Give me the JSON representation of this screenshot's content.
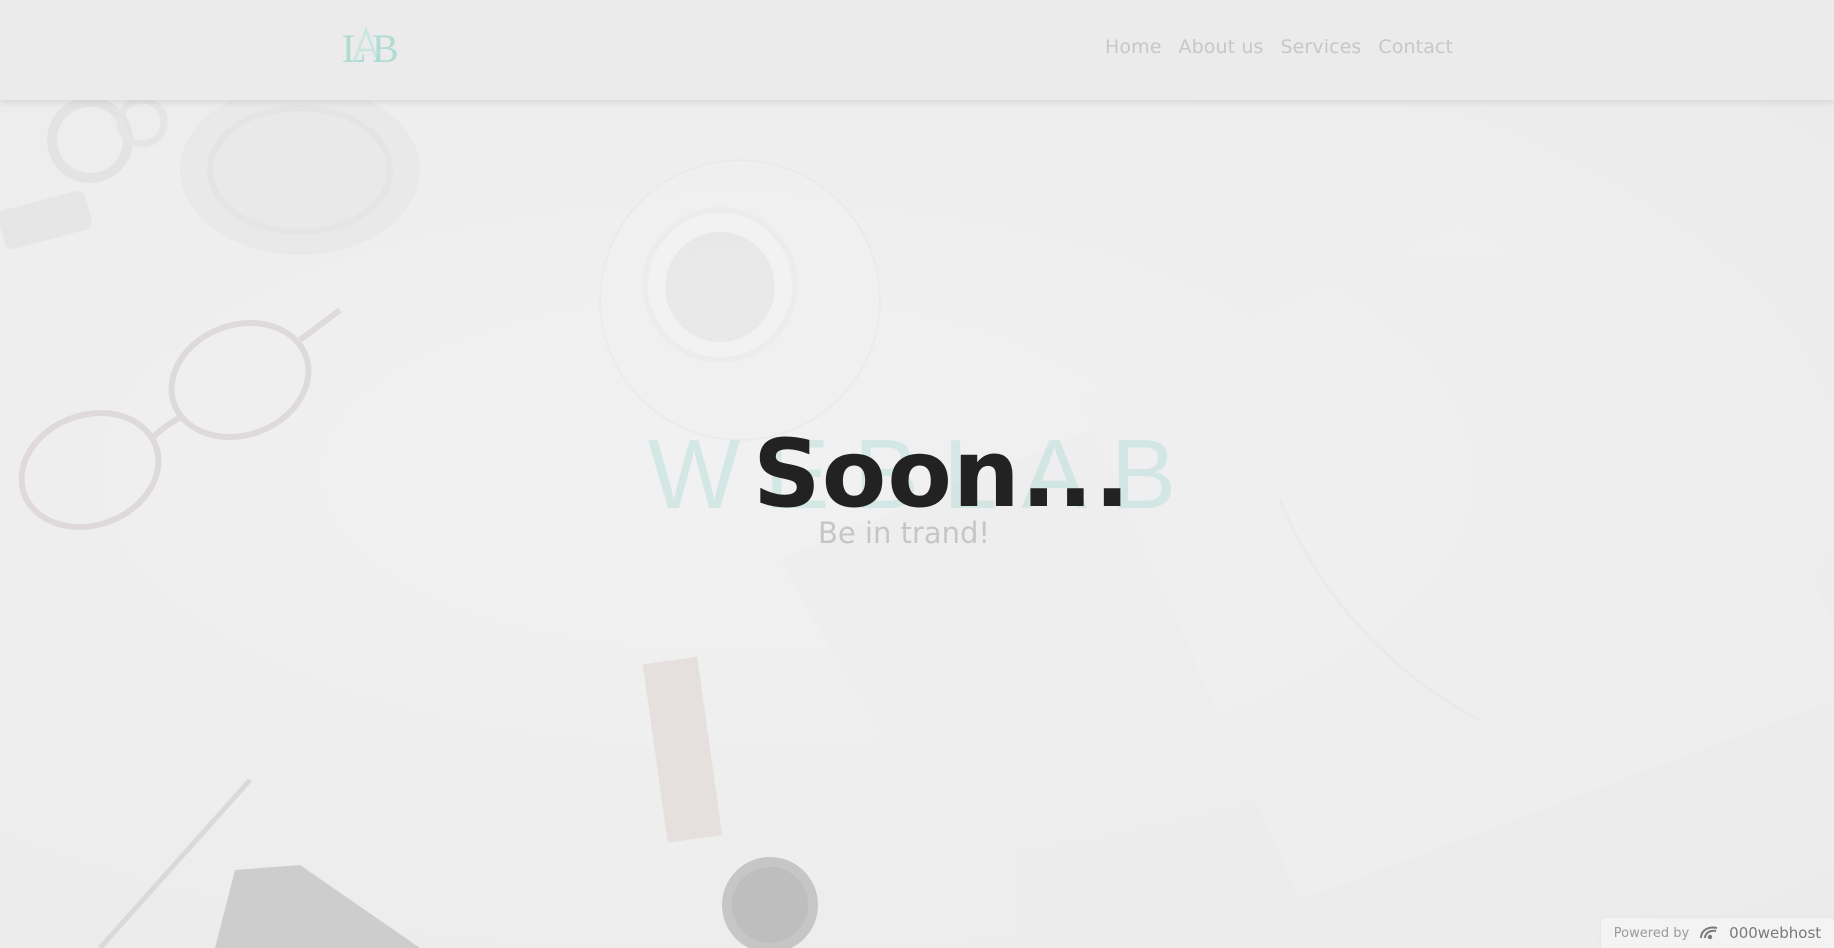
{
  "header": {
    "logo_text": "LAB",
    "nav": [
      "Home",
      "About us",
      "Services",
      "Contact"
    ]
  },
  "hero": {
    "brand_text": "WEBLAB",
    "headline": "Soon...",
    "tagline": "Be in trand!"
  },
  "footer": {
    "powered_label": "Powered by",
    "powered_brand": "000webhost",
    "powered_icon": "000webhost-logo-icon"
  },
  "colors": {
    "accent": "#96d7cd",
    "headline": "#222222",
    "nav_text": "#c7c7c7"
  }
}
